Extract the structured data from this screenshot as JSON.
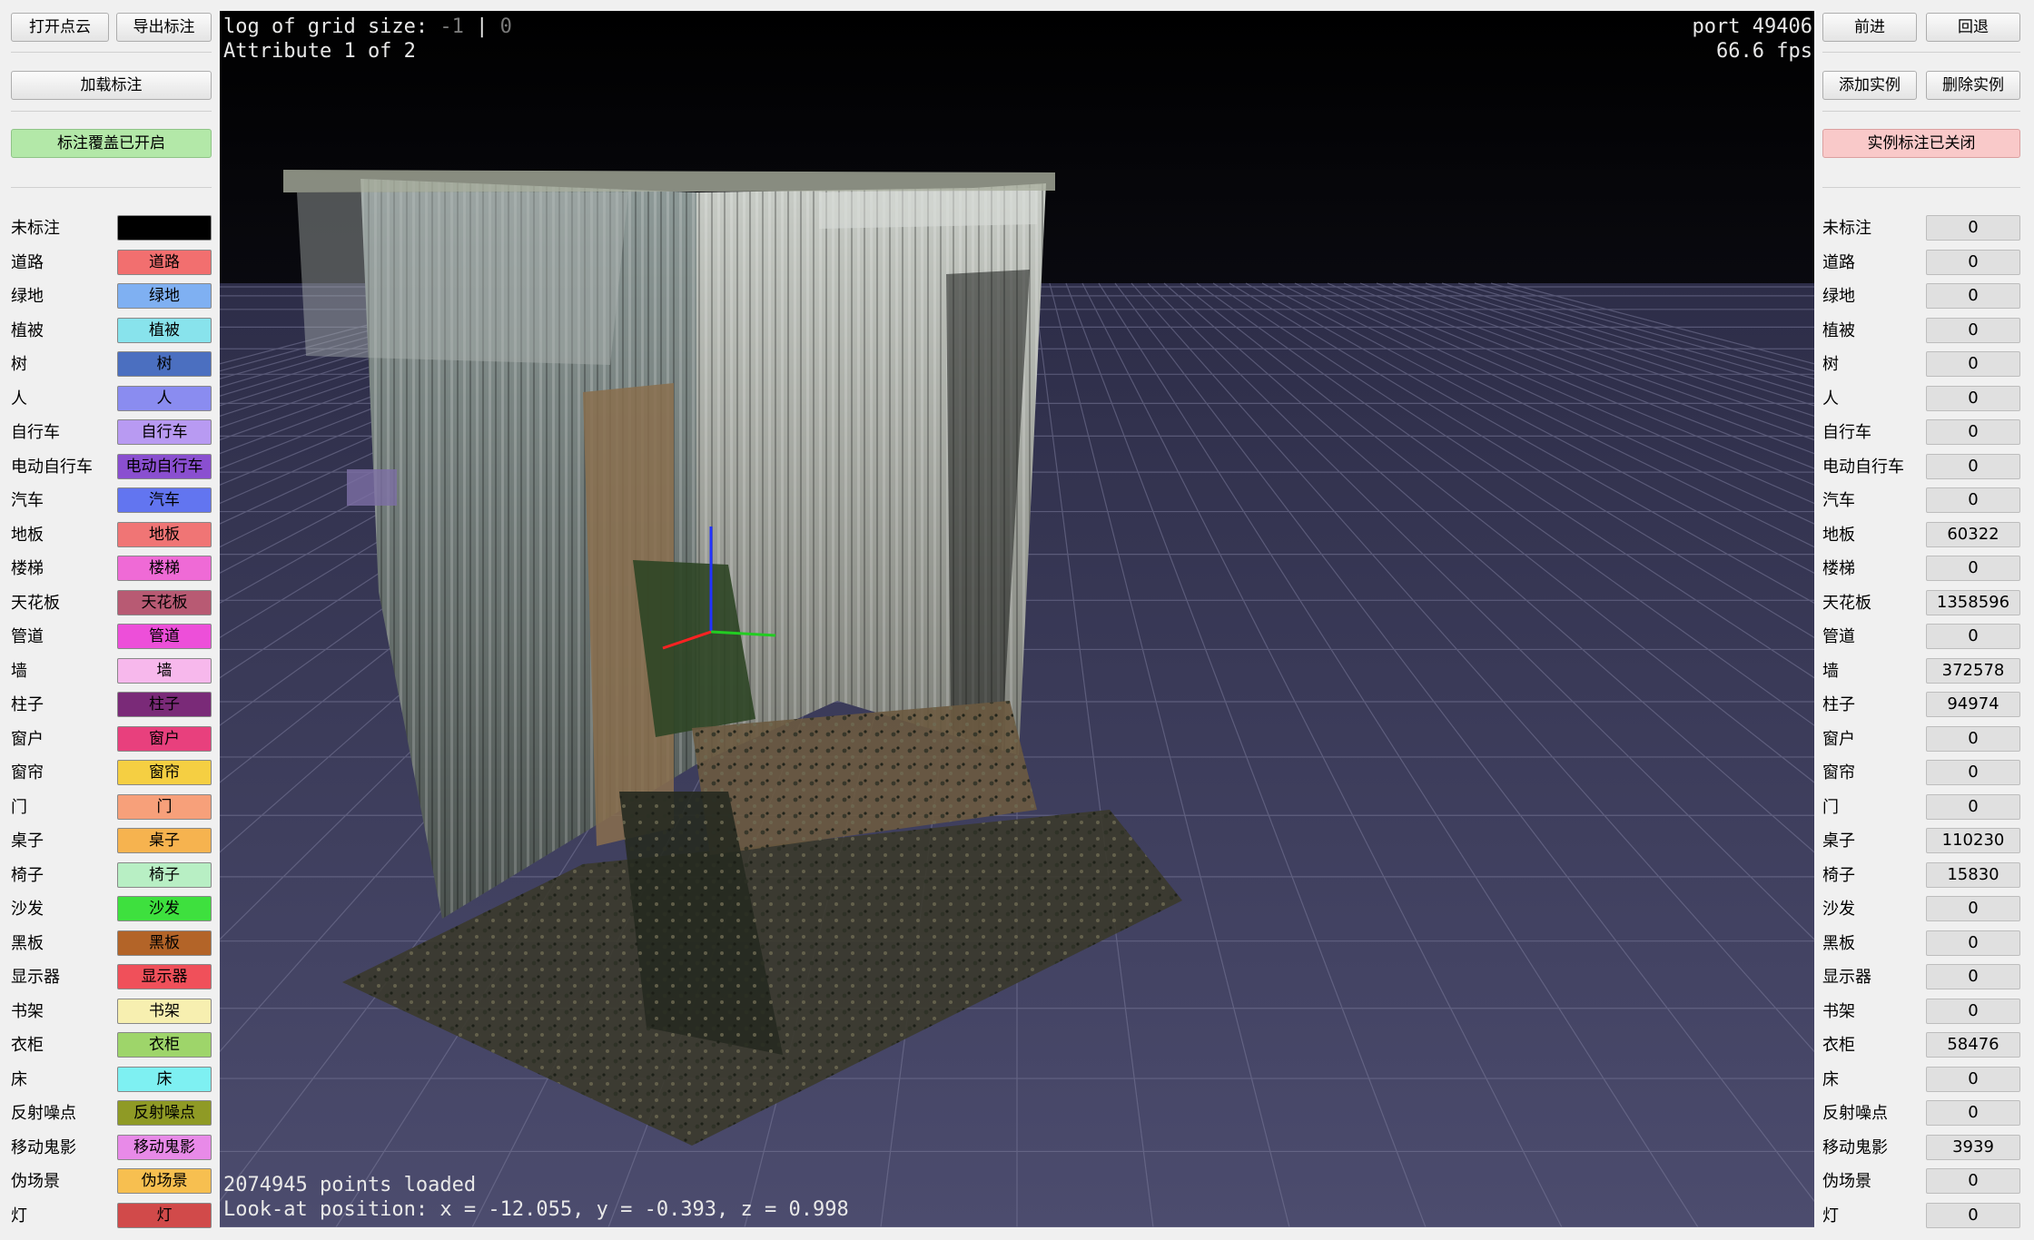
{
  "left_toolbar": {
    "open_pointcloud": "打开点云",
    "export_labels": "导出标注",
    "load_labels": "加载标注",
    "label_overlay_toggle": "标注覆盖已开启"
  },
  "right_toolbar": {
    "forward": "前进",
    "back": "回退",
    "add_instance": "添加实例",
    "delete_instance": "删除实例",
    "instance_label_toggle": "实例标注已关闭"
  },
  "viewport": {
    "grid_size_prefix": "log of grid size: ",
    "grid_size_value": "-1",
    "grid_size_sep": " | ",
    "grid_size_alt": "0",
    "attribute": "Attribute 1 of 2",
    "port": "port 49406",
    "fps": "66.6 fps",
    "points_loaded": "2074945 points loaded",
    "look_at": "Look-at position: x = -12.055, y = -0.393, z = 0.998"
  },
  "classes": [
    {
      "name": "未标注",
      "color": "#000000",
      "count": "0"
    },
    {
      "name": "道路",
      "color": "#f26f6f",
      "count": "0"
    },
    {
      "name": "绿地",
      "color": "#7fb0f2",
      "count": "0"
    },
    {
      "name": "植被",
      "color": "#88e3ec",
      "count": "0"
    },
    {
      "name": "树",
      "color": "#4b6fc0",
      "count": "0"
    },
    {
      "name": "人",
      "color": "#8a8cf0",
      "count": "0"
    },
    {
      "name": "自行车",
      "color": "#b89af2",
      "count": "0"
    },
    {
      "name": "电动自行车",
      "color": "#8a4fd0",
      "count": "0"
    },
    {
      "name": "汽车",
      "color": "#6275f0",
      "count": "0"
    },
    {
      "name": "地板",
      "color": "#f07575",
      "count": "60322"
    },
    {
      "name": "楼梯",
      "color": "#ef6ad6",
      "count": "0"
    },
    {
      "name": "天花板",
      "color": "#b85a73",
      "count": "1358596"
    },
    {
      "name": "管道",
      "color": "#ed4fd9",
      "count": "0"
    },
    {
      "name": "墙",
      "color": "#f7b8ec",
      "count": "372578"
    },
    {
      "name": "柱子",
      "color": "#7a2a78",
      "count": "94974"
    },
    {
      "name": "窗户",
      "color": "#e8407d",
      "count": "0"
    },
    {
      "name": "窗帘",
      "color": "#f5cf42",
      "count": "0"
    },
    {
      "name": "门",
      "color": "#f7a07a",
      "count": "0"
    },
    {
      "name": "桌子",
      "color": "#f6b34f",
      "count": "110230"
    },
    {
      "name": "椅子",
      "color": "#b8efc4",
      "count": "15830"
    },
    {
      "name": "沙发",
      "color": "#3ee03e",
      "count": "0"
    },
    {
      "name": "黑板",
      "color": "#b36428",
      "count": "0"
    },
    {
      "name": "显示器",
      "color": "#f0505a",
      "count": "0"
    },
    {
      "name": "书架",
      "color": "#f7efb0",
      "count": "0"
    },
    {
      "name": "衣柜",
      "color": "#9ed56a",
      "count": "58476"
    },
    {
      "name": "床",
      "color": "#7ef0f2",
      "count": "0"
    },
    {
      "name": "反射噪点",
      "color": "#8f9a25",
      "count": "0"
    },
    {
      "name": "移动鬼影",
      "color": "#e88ae8",
      "count": "3939"
    },
    {
      "name": "伪场景",
      "color": "#f7bf50",
      "count": "0"
    },
    {
      "name": "灯",
      "color": "#d14a4a",
      "count": "0"
    }
  ]
}
